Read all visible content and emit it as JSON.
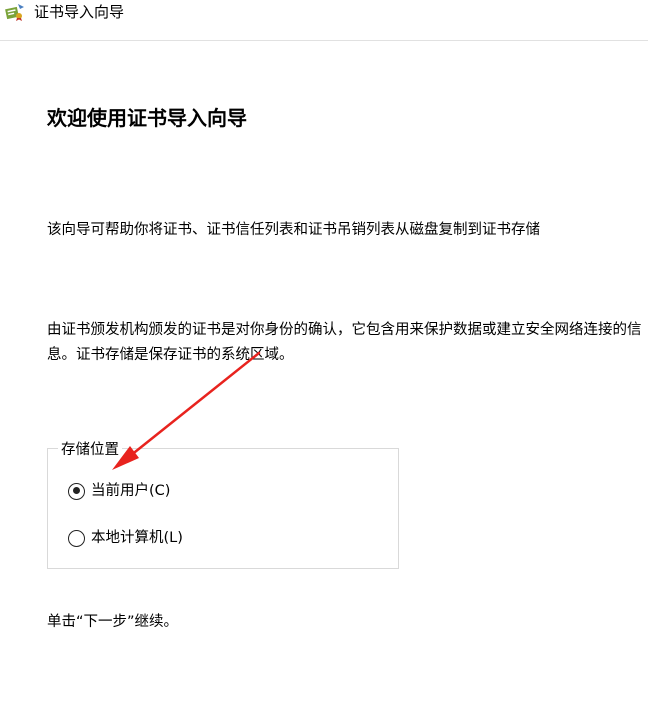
{
  "window": {
    "title": "证书导入向导",
    "icon": "certificate-wizard-icon"
  },
  "main": {
    "heading": "欢迎使用证书导入向导",
    "intro": "该向导可帮助你将证书、证书信任列表和证书吊销列表从磁盘复制到证书存储",
    "description_line1": "由证书颁发机构颁发的证书是对你身份的确认，它包含用来保护数据或建立安全网络连接的信",
    "description_line2": "息。证书存储是保存证书的系统区域。",
    "store_location": {
      "legend": "存储位置",
      "options": [
        {
          "label": "当前用户(C)",
          "selected": true
        },
        {
          "label": "本地计算机(L)",
          "selected": false
        }
      ]
    },
    "continue_hint": "单击“下一步”继续。"
  },
  "annotation": {
    "color": "#e8231e",
    "icon": "red-arrow-annotation"
  }
}
